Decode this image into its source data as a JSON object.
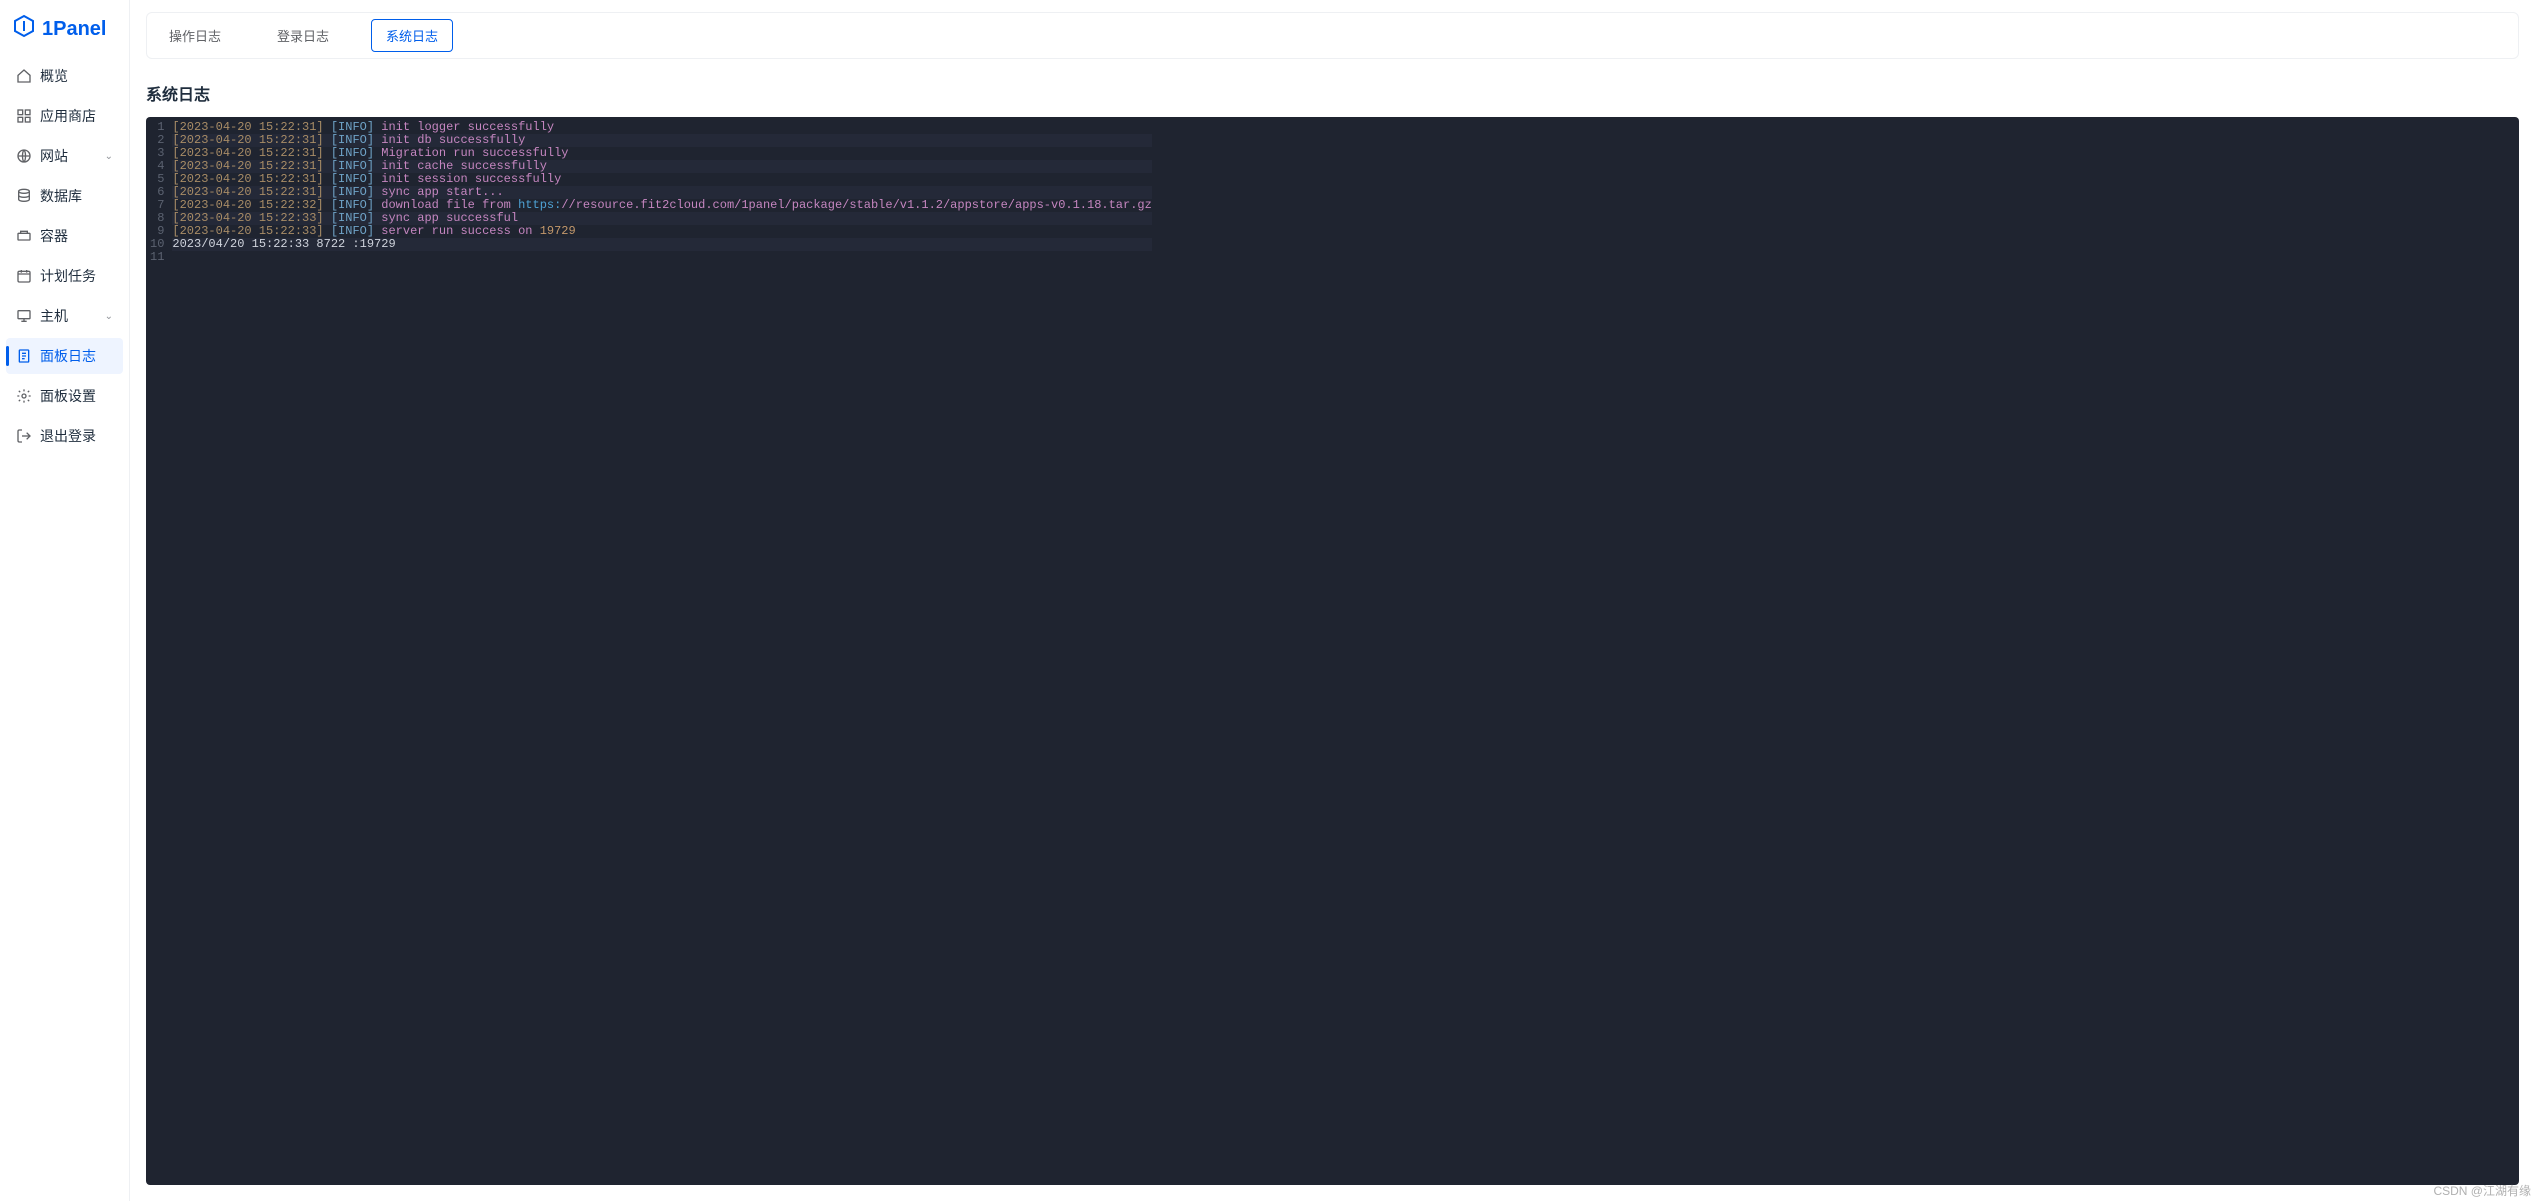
{
  "brand": "1Panel",
  "sidebar": {
    "items": [
      {
        "label": "概览",
        "icon": "home-icon",
        "expandable": false
      },
      {
        "label": "应用商店",
        "icon": "apps-icon",
        "expandable": false
      },
      {
        "label": "网站",
        "icon": "globe-icon",
        "expandable": true
      },
      {
        "label": "数据库",
        "icon": "database-icon",
        "expandable": false
      },
      {
        "label": "容器",
        "icon": "container-icon",
        "expandable": false
      },
      {
        "label": "计划任务",
        "icon": "schedule-icon",
        "expandable": false
      },
      {
        "label": "主机",
        "icon": "host-icon",
        "expandable": true
      },
      {
        "label": "面板日志",
        "icon": "log-icon",
        "expandable": false,
        "active": true
      },
      {
        "label": "面板设置",
        "icon": "gear-icon",
        "expandable": false
      },
      {
        "label": "退出登录",
        "icon": "logout-icon",
        "expandable": false
      }
    ]
  },
  "tabs": [
    {
      "label": "操作日志"
    },
    {
      "label": "登录日志"
    },
    {
      "label": "系统日志",
      "active": true
    }
  ],
  "page_title": "系统日志",
  "log": {
    "lines": [
      {
        "stamp": "[2023-04-20 15:22:31]",
        "lvl": "[INFO]",
        "msg": "init logger successfully"
      },
      {
        "stamp": "[2023-04-20 15:22:31]",
        "lvl": "[INFO]",
        "msg": "init db successfully"
      },
      {
        "stamp": "[2023-04-20 15:22:31]",
        "lvl": "[INFO]",
        "msg": "Migration run successfully"
      },
      {
        "stamp": "[2023-04-20 15:22:31]",
        "lvl": "[INFO]",
        "msg": "init cache successfully"
      },
      {
        "stamp": "[2023-04-20 15:22:31]",
        "lvl": "[INFO]",
        "msg": "init session successfully"
      },
      {
        "stamp": "[2023-04-20 15:22:31]",
        "lvl": "[INFO]",
        "msg": "sync app start..."
      },
      {
        "stamp": "[2023-04-20 15:22:32]",
        "lvl": "[INFO]",
        "msg": "download file from ",
        "url_label": "https:",
        "url_rest": "//resource.fit2cloud.com/1panel/package/stable/v1.1.2/appstore/apps-v0.1.18.tar.gz"
      },
      {
        "stamp": "[2023-04-20 15:22:33]",
        "lvl": "[INFO]",
        "msg": "sync app successful"
      },
      {
        "stamp": "[2023-04-20 15:22:33]",
        "lvl": "[INFO]",
        "msg": "server run success on ",
        "num": "19729"
      },
      {
        "raw": "2023/04/20 15:22:33 8722 :19729"
      }
    ],
    "extra_gutter": 1
  },
  "watermark": "CSDN @江湖有缘"
}
